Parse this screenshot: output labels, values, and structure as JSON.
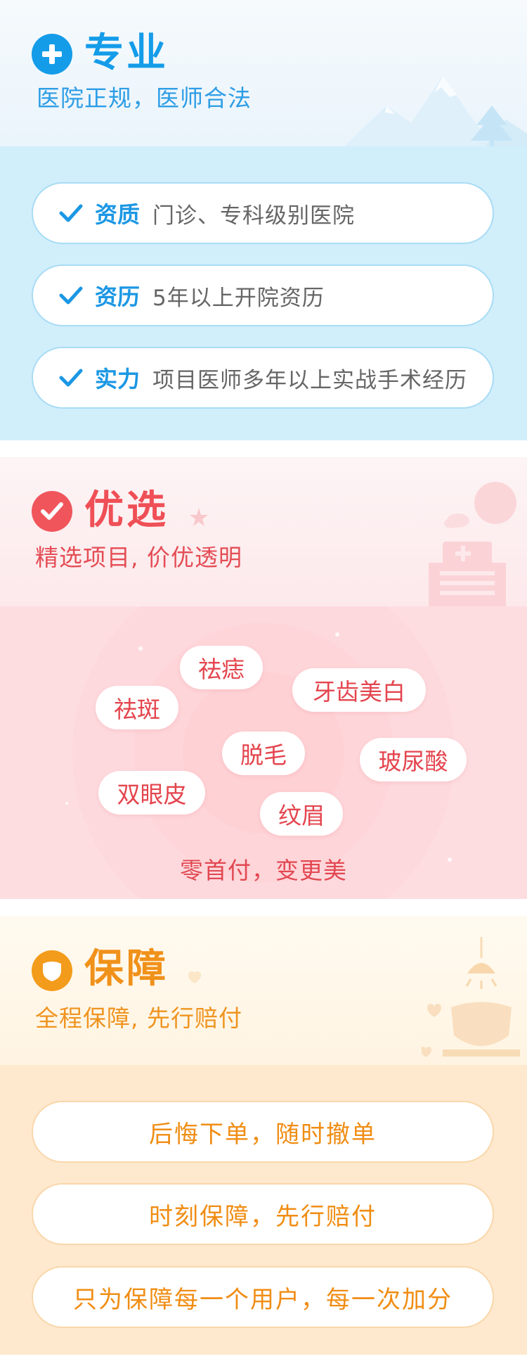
{
  "colors": {
    "blue": "#149ce9",
    "blue_bg": "#d1eefb",
    "red": "#ef4f56",
    "red_bg": "#fddde0",
    "orange": "#f0911a",
    "orange_bg": "#fee9cf"
  },
  "professional": {
    "icon": "plus-circle-icon",
    "title": "专业",
    "subtitle": "医院正规，医师合法",
    "items": [
      {
        "key": "资质",
        "value": "门诊、专科级别医院"
      },
      {
        "key": "资历",
        "value": "5年以上开院资历"
      },
      {
        "key": "实力",
        "value": "项目医师多年以上实战手术经历"
      }
    ]
  },
  "selection": {
    "icon": "check-circle-icon",
    "title": "优选",
    "subtitle": "精选项目, 价优透明",
    "tags": [
      "祛痣",
      "祛斑",
      "牙齿美白",
      "脱毛",
      "玻尿酸",
      "双眼皮",
      "纹眉"
    ],
    "slogan": "零首付，变更美"
  },
  "guarantee": {
    "icon": "shield-icon",
    "title": "保障",
    "subtitle": "全程保障, 先行赔付",
    "items": [
      "后悔下单，随时撤单",
      "时刻保障，先行赔付",
      "只为保障每一个用户，每一次加分"
    ]
  }
}
